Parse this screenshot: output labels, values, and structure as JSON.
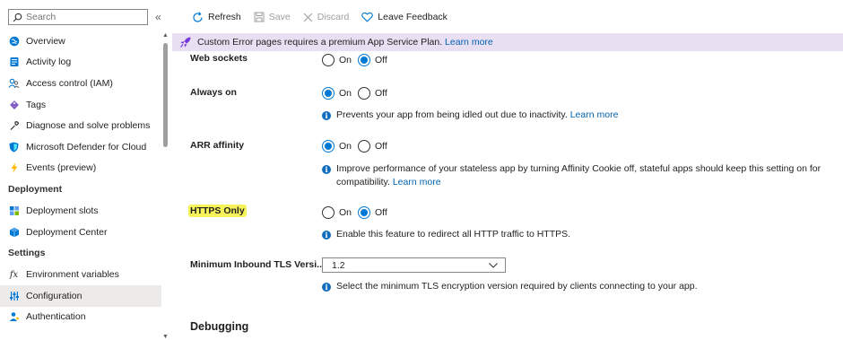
{
  "sidebar": {
    "search_placeholder": "Search",
    "collapse_glyph": "«",
    "items": [
      {
        "label": "Overview",
        "icon": "globe-icon"
      },
      {
        "label": "Activity log",
        "icon": "activity-log-icon"
      },
      {
        "label": "Access control (IAM)",
        "icon": "people-icon"
      },
      {
        "label": "Tags",
        "icon": "tag-icon"
      },
      {
        "label": "Diagnose and solve problems",
        "icon": "wrench-icon"
      },
      {
        "label": "Microsoft Defender for Cloud",
        "icon": "shield-icon"
      },
      {
        "label": "Events (preview)",
        "icon": "lightning-icon"
      }
    ],
    "sections": {
      "deployment": {
        "title": "Deployment",
        "items": [
          {
            "label": "Deployment slots",
            "icon": "slots-icon"
          },
          {
            "label": "Deployment Center",
            "icon": "cube-icon"
          }
        ]
      },
      "settings": {
        "title": "Settings",
        "items": [
          {
            "label": "Environment variables",
            "icon": "fx-icon"
          },
          {
            "label": "Configuration",
            "icon": "sliders-icon"
          },
          {
            "label": "Authentication",
            "icon": "person-key-icon"
          }
        ]
      }
    },
    "selected": "Configuration"
  },
  "toolbar": {
    "refresh": "Refresh",
    "save": "Save",
    "discard": "Discard",
    "feedback": "Leave Feedback"
  },
  "banner": {
    "text": "Custom Error pages requires a premium App Service Plan.",
    "link": "Learn more"
  },
  "settings": {
    "web_sockets": {
      "label": "Web sockets",
      "on": "On",
      "off": "Off",
      "value": "Off"
    },
    "always_on": {
      "label": "Always on",
      "on": "On",
      "off": "Off",
      "value": "On",
      "info": "Prevents your app from being idled out due to inactivity.",
      "link": "Learn more"
    },
    "arr_affinity": {
      "label": "ARR affinity",
      "on": "On",
      "off": "Off",
      "value": "On",
      "info_line1": "Improve performance of your stateless app by turning Affinity Cookie off, stateful apps should keep this setting on for",
      "info_line2": "compatibility.",
      "link": "Learn more"
    },
    "https_only": {
      "label": "HTTPS Only",
      "on": "On",
      "off": "Off",
      "value": "Off",
      "info": "Enable this feature to redirect all HTTP traffic to HTTPS."
    },
    "min_tls": {
      "label": "Minimum Inbound TLS Versi...",
      "value": "1.2",
      "info": "Select the minimum TLS encryption version required by clients connecting to your app."
    }
  },
  "debugging": {
    "title": "Debugging"
  },
  "colors": {
    "accent": "#0078d4",
    "banner_bg": "#e9dff2",
    "highlight": "#f6f35a",
    "link": "#0063b1"
  }
}
